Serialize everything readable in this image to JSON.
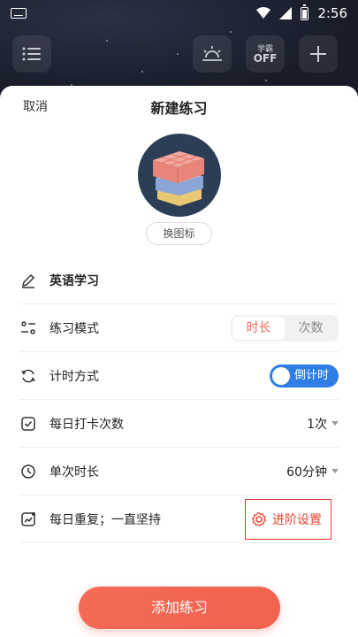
{
  "status_bar": {
    "time": "2:56"
  },
  "toolbar": {
    "study_off_top": "学霸",
    "study_off_bottom": "OFF"
  },
  "sheet": {
    "cancel_label": "取消",
    "title": "新建练习",
    "change_icon_label": "换图标"
  },
  "rows": {
    "name": {
      "label": "英语学习"
    },
    "mode": {
      "label": "练习模式",
      "options": [
        "时长",
        "次数"
      ],
      "selected": "时长"
    },
    "timing": {
      "label": "计时方式",
      "value": "倒计时"
    },
    "daily_count": {
      "label": "每日打卡次数",
      "value": "1次"
    },
    "duration": {
      "label": "单次时长",
      "value": "60分钟"
    },
    "repeat": {
      "label": "每日重复；一直坚持",
      "advanced_label": "进阶设置"
    }
  },
  "add_button": {
    "label": "添加练习"
  },
  "colors": {
    "accent": "#f26b57",
    "toggle_blue": "#2e7ee6",
    "highlight_red": "#e33333",
    "sheet_bg": "#ffffff",
    "top_bg": "#1c2130"
  },
  "icons": [
    "keyboard-icon",
    "wifi-icon",
    "signal-icon",
    "battery-icon",
    "list-icon",
    "sunset-icon",
    "plus-icon",
    "pencil-icon",
    "mode-icon",
    "refresh-icon",
    "checkbox-icon",
    "clock-icon",
    "trend-icon",
    "gear-icon",
    "caret-icon"
  ]
}
